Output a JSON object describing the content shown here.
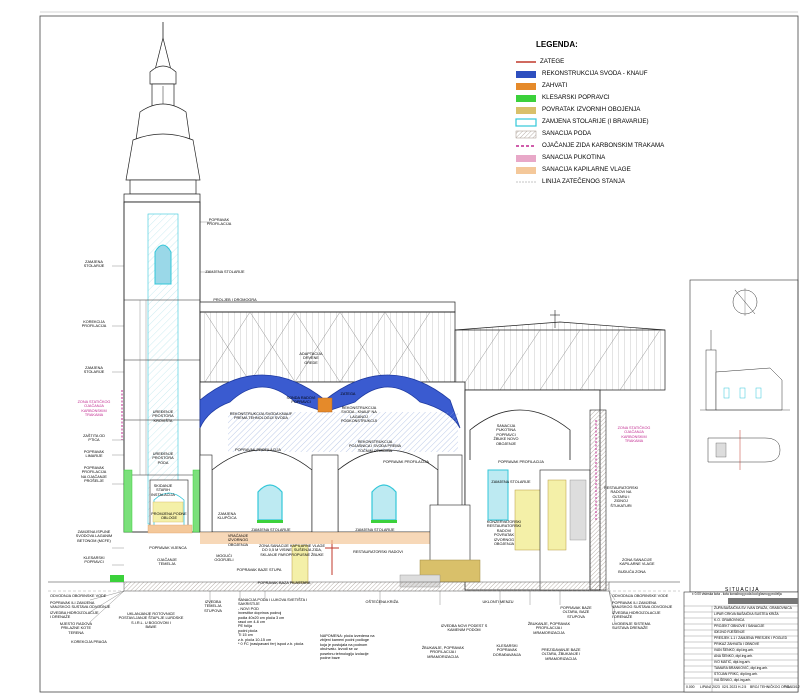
{
  "legend": {
    "title": "LEGENDA:",
    "items": [
      {
        "label": "ZATEGE",
        "color": "#c0392b",
        "style": "line"
      },
      {
        "label": "REKONSTRUKCIJA SVODA - KNAUF",
        "color": "#2e4fbf",
        "style": "fill"
      },
      {
        "label": "ZAHVATI",
        "color": "#e58a2a",
        "style": "fill"
      },
      {
        "label": "KLESARSKI POPRAVCI",
        "color": "#3bd13b",
        "style": "fill"
      },
      {
        "label": "POVRATAK IZVORNIH OBOJENJA",
        "color": "#d9c06a",
        "style": "fill"
      },
      {
        "label": "ZAMJENA STOLARIJE (I BRAVARIJE)",
        "color": "#33c7d9",
        "style": "outline"
      },
      {
        "label": "SANACIJA PODA",
        "color": "#8c7a6b",
        "style": "hatch"
      },
      {
        "label": "OJAČANJE ZIDA KARBONSKIM TRAKAMA",
        "color": "#c0278f",
        "style": "dash"
      },
      {
        "label": "SANACIJA PUKOTINA",
        "color": "#e8a8c8",
        "style": "fill"
      },
      {
        "label": "SANACIJA KAPILARNE VLAGE",
        "color": "#f4c89a",
        "style": "fill"
      },
      {
        "label": "LINIJA ZATEČENOG STANJA",
        "color": "#888888",
        "style": "thin"
      }
    ]
  },
  "labels": {
    "popravak_profilacija_top": "POPRAVAK\nPROFILACIJA",
    "zamjena_stolarije_1": "ZAMJENA\nSTOLARIJE",
    "zamjena_stolarije_2": "ZAMJENA STOLARIJE",
    "korekcija_profilacija": "KOREKCIJA\nPROFILACIJA",
    "zamjena_stolarije_3": "ZAMJENA\nSTOLARIJE",
    "zona_staticko_left": "ZONA STATIČKOG\nOJAČANJA\nKARBONSKIM\nTRAKAMA",
    "zona_staticko_right": "ZONA STATIČKOG\nOJAČANJA\nKARBONSKIM\nTRAKAMA",
    "zastita_od_ptica": "ZAŠTITA OD\nPTICA",
    "popravak_limarije": "POPRAVAK\nLIMARIJE",
    "popravak_profilacija_left": "POPRAVAK\nPROFILACIJA\nNA OJAČANJE\nPROŠELJE",
    "uredjenje_prostor": "UREĐENJE\nPROSTORA\nKROVIŠTA",
    "uredjenje_poda": "UREĐENJE\nPROSTORA\nPODA",
    "skidanje_staru": "SKIDANJE\nSTARIH\nINSTALACIJA",
    "promjena_podne": "PROMJENA PODNE\nOBLOGE",
    "zamjena_ispune": "ZAMJENA ISPUNE\nSVODOVA LAGANIM\nBETONOM (MCFE)",
    "klesarski_popravci": "KLESARSKI\nPOPRAVCI",
    "popravak_vijenca": "POPRAVAK VIJENCA",
    "ojacanje_temelja": "OJAČANJE\nTEMELJA",
    "mogući_ogoreli": "MOGUĆI\nOGORJELI",
    "popravak_baze": "POPRAVAK BAZE STUPA",
    "proljeb_dromo": "PROLJEB I DROMOGRA",
    "rekonstrukcija_svoda": "REKONSTRUKCIJA SVODA KNAUF\nPREMA TEHNOLOGIJI SVODA",
    "sonda_radovi": "SONDA RADOVI\nPOPRAVCI",
    "adaptacija_grede": "ADAPTACIJA\nDRVENE\nGREDE",
    "rekonstrukcija_svoda_2": "REKONSTRUKCIJA\nSVODA - KNAUF NA\nLAGANOJ\nPODKONSTRUKCIJI",
    "zatega": "ZATEGA",
    "sanacija_pukotina": "SANACIJA\nPUKOTINA\nPOPRAVCI\nŽBUKE NOVO\nOBOJENJE",
    "popravak_profilacija_mid": "POPRAVAK PROFILACIJA",
    "popravak_profilacija_mid2": "POPRAVAK PROFILACIJA",
    "popravak_profilacija_right": "POPRAVAK PROFILACIJA",
    "rekonstrukcija_pojasnica": "REKONSTRUKCIJA\nPOJASNICA I SVODA PREMA\nTOČNIM OTISCIMA",
    "zamjena_stolarije_4": "ZAMJENA STOLARIJE",
    "zamjena_stolarije_5": "ZAMJENA STOLARIJE",
    "zamjena_stolarije_6": "ZAMJENA STOLARIJE",
    "zamjena_klupcica": "ZAMJENA\nKLUPČICA",
    "vracanje_izvornog": "VRAĆANJE\nIZVORNOG\nOBOJENJA",
    "zona_sanacije": "ZONA SANACIJE KAPILARNE VLAGE\nDO 0,5 M VISINE, SUŠENJA ZIDA,\nSKLANJE PAROPROPUSNE ŽBUKE",
    "restauratorski": "RESTAURATORSKI RADOVI",
    "konzervatorski": "KONZERVATORSKI\nRESTAURATORSKI\nRADOVI\nPOVRATAK\nIZVORNOG\nOBOJENJA",
    "restaur_radovi_oltar": "RESTAURATORSKI\nRADOVI NA\nOLTARU I\nZIDNOJ\nŠTUKATURI",
    "zona_sanacije_right": "ZONA SANACIJE\nKAPILARNE VLAGE",
    "buduca_zona": "BUDUĆA ZONA",
    "popravak_baze_pilastara": "POPRAVAK BAZA PILASTARA",
    "odvodnja": "ODVODNJA OBORINSKE VODE",
    "popravak_zamjena_left": "POPRAVAK ILI ZAMJENA\nVANJSKOG SUSTAVA ODVODNJE",
    "izvedba_hidroizol": "IZVEDBA HIDROIZOLACIJE\nI DRENAŽE",
    "mjesto_radova": "MJESTO RADOVA\nPRILAZNE KOTE\nTERENA",
    "korekcija_praga": "KOREKCIJA PRAGA",
    "uklanjanje_rotovnice": "UKLANJANJE ROTOVNICE\nPOSTAVLJANJE ŠTAPLJE LURDSKE\nS.I.R.L. U BOGOVOM I\nBAWE",
    "izvedba_temelja": "IZVEDBA\nTEMELJA\nSTUPOVA",
    "sanacija_poda": "SANACIJA PODA I LUKOVA SVETIŠTA I SAKRISTIJE\n- NOVI POD\ninvestitor doprinos podnoj\npodia 40x20 cm ploča 3 cm\nrasol cm 4-6 cm\nPE folija\npodni ploča\nTI 15 cm\nz.b. ploča 10-15 cm\n* 0 FC (nasipavani fer) ispod z.b. ploča",
    "napomena": "NAPOMENA: ploča izvedena na\nzbijeni kameni podni podloge\nkoja je postojala na podnom\nobuhvatu. Izvodi se uz\nposebnu tehnologiju izolacije\npodne baze",
    "ostecena_kriza": "OŠTEĆENA KRIŽA",
    "uklonti_menzu": "UKLONTI MENZU",
    "izvedba_novi_podest": "IZVEDBA NOVI PODEST S\nKAMENIM PODOM",
    "zbukanje_popravak": "ŽBUKANJE, POPRAVAK\nPROFILACIJA I\nMRAMORIZACIJA",
    "zbukanje_popravak_2": "ŽBUKANJE, POPRAVAK\nPROFILACIJA I\nMRAMORIZACIJA",
    "klesarski_popravak": "KLESARSKI\nPOPRAVAK\nDORAĐAVANJA",
    "prezidavanje_baze": "PREZIDAVANJE BAZE\nOLTARA, ŽBUKANJE I\nMRAMORIZACIJA",
    "popravak_baze_oltar": "POPRAVAK BAZE\nOLTARA, BAZE\nSTUPOVA",
    "odvodnja_right": "ODVODNJA OBORINSKE VODE",
    "popravak_zamjena_right": "POPRAVAK ILI ZAMJENA\nVANJSKOG SUSTAVA ODVODNJE",
    "izvedba_drenaze_right": "IZVEDBA HIDROIZOLACIJE\nI DRENAŽE",
    "uvodenje_sustava": "UVOĐENJE SISTEMA\nSUSTAVA DRENAŽE"
  },
  "situacija": "SITUACIJA",
  "title_block": {
    "note": "± 0.00 visinska kota - kota konačnog poda kod glavnog pročelja",
    "rows": [
      "ŽUPA BAŠAIČKA SV. IVAN DRAŽA, GRABOVNICA",
      "LIPAR CRKVA BAŠAIČKA SUSTEA KRIŽA",
      "K.O. GRABOVNICA",
      "PROJEKT OBNOVE I SANACIJE",
      "IDEJNO RJEŠENJE",
      "PRESJEK 1-1 I ZAMJENA PRESJEK I POGLED",
      "PRIKAZ ZAHVATA I OBNOVE",
      "IVAN ŠENKO, dipl.ing.arh.",
      "ANA ŠENKO, dipl.ing.arh.",
      "IVO MATIĆ, dipl.ing.arh.",
      "TAMARA BRANKOVIĆ, dipl.ing.arh.",
      "STOJAN FRIKC, dipl.ing.arh.",
      "IVA ŠENKO, dipl.ing.arh."
    ],
    "footer": [
      "0.000",
      "LIPANJ 2023",
      "02/1 2023",
      "H-2.5",
      "BROJ TEHNIČKOG OPISA",
      "T.O. 03/12"
    ]
  }
}
